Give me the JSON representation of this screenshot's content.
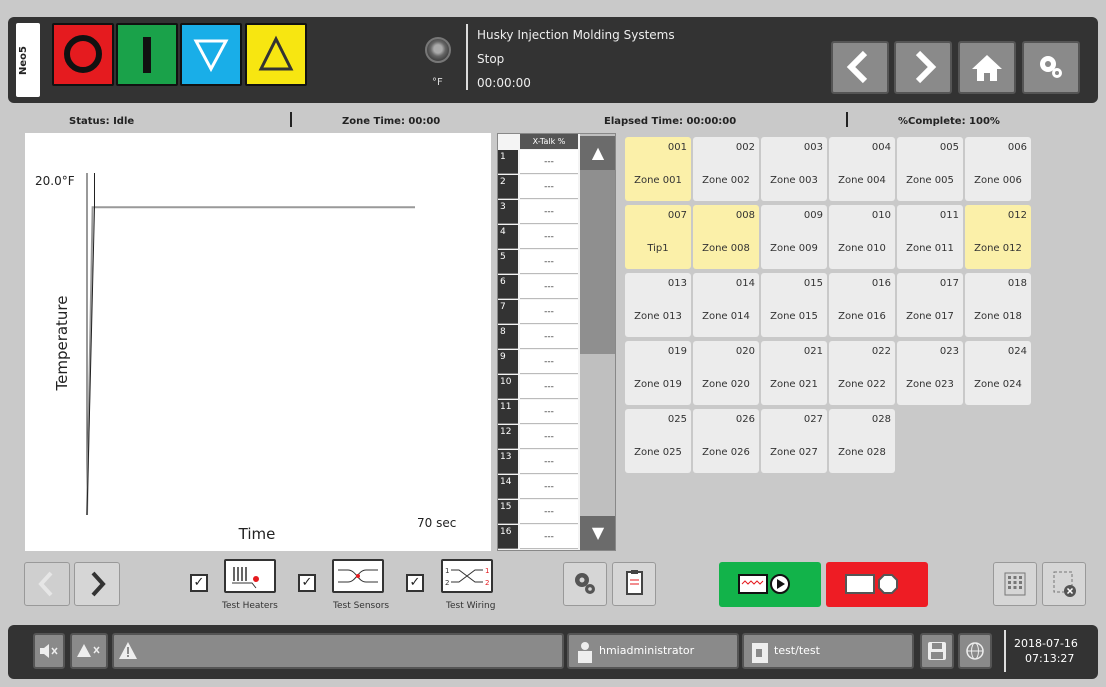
{
  "header": {
    "neo_tab": "Neo5",
    "unit": "°F",
    "company": "Husky Injection Molding Systems",
    "state": "Stop",
    "clock": "00:00:00"
  },
  "status": {
    "status": "Status: Idle",
    "zone_time": "Zone Time: 00:00",
    "elapsed": "Elapsed Time: 00:00:00",
    "complete": "%Complete: 100%"
  },
  "chart_data": {
    "type": "line",
    "ylabel": "Temperature",
    "xlabel": "Time",
    "y_max_label": "20.0°F",
    "x_max_label": "70 sec",
    "series": [
      {
        "x": [
          0,
          1.2,
          70
        ],
        "y": [
          0,
          18,
          18
        ]
      },
      {
        "x": [
          0,
          1.6,
          1.6
        ],
        "y": [
          0,
          18,
          20
        ]
      }
    ],
    "xlim": [
      0,
      70
    ],
    "ylim": [
      0,
      20
    ],
    "grid": false
  },
  "xtalk": {
    "header": "X-Talk %",
    "rows": [
      {
        "n": "1",
        "v": "---"
      },
      {
        "n": "2",
        "v": "---"
      },
      {
        "n": "3",
        "v": "---"
      },
      {
        "n": "4",
        "v": "---"
      },
      {
        "n": "5",
        "v": "---"
      },
      {
        "n": "6",
        "v": "---"
      },
      {
        "n": "7",
        "v": "---"
      },
      {
        "n": "8",
        "v": "---"
      },
      {
        "n": "9",
        "v": "---"
      },
      {
        "n": "10",
        "v": "---"
      },
      {
        "n": "11",
        "v": "---"
      },
      {
        "n": "12",
        "v": "---"
      },
      {
        "n": "13",
        "v": "---"
      },
      {
        "n": "14",
        "v": "---"
      },
      {
        "n": "15",
        "v": "---"
      },
      {
        "n": "16",
        "v": "---"
      }
    ]
  },
  "zones": [
    {
      "id": "001",
      "name": "Zone 001",
      "hl": true
    },
    {
      "id": "002",
      "name": "Zone 002",
      "hl": false
    },
    {
      "id": "003",
      "name": "Zone 003",
      "hl": false
    },
    {
      "id": "004",
      "name": "Zone 004",
      "hl": false
    },
    {
      "id": "005",
      "name": "Zone 005",
      "hl": false
    },
    {
      "id": "006",
      "name": "Zone 006",
      "hl": false
    },
    {
      "id": "007",
      "name": "Tip1",
      "hl": true
    },
    {
      "id": "008",
      "name": "Zone 008",
      "hl": true
    },
    {
      "id": "009",
      "name": "Zone 009",
      "hl": false
    },
    {
      "id": "010",
      "name": "Zone 010",
      "hl": false
    },
    {
      "id": "011",
      "name": "Zone 011",
      "hl": false
    },
    {
      "id": "012",
      "name": "Zone 012",
      "hl": true
    },
    {
      "id": "013",
      "name": "Zone 013",
      "hl": false
    },
    {
      "id": "014",
      "name": "Zone 014",
      "hl": false
    },
    {
      "id": "015",
      "name": "Zone 015",
      "hl": false
    },
    {
      "id": "016",
      "name": "Zone 016",
      "hl": false
    },
    {
      "id": "017",
      "name": "Zone 017",
      "hl": false
    },
    {
      "id": "018",
      "name": "Zone 018",
      "hl": false
    },
    {
      "id": "019",
      "name": "Zone 019",
      "hl": false
    },
    {
      "id": "020",
      "name": "Zone 020",
      "hl": false
    },
    {
      "id": "021",
      "name": "Zone 021",
      "hl": false
    },
    {
      "id": "022",
      "name": "Zone 022",
      "hl": false
    },
    {
      "id": "023",
      "name": "Zone 023",
      "hl": false
    },
    {
      "id": "024",
      "name": "Zone 024",
      "hl": false
    },
    {
      "id": "025",
      "name": "Zone 025",
      "hl": false
    },
    {
      "id": "026",
      "name": "Zone 026",
      "hl": false
    },
    {
      "id": "027",
      "name": "Zone 027",
      "hl": false
    },
    {
      "id": "028",
      "name": "Zone 028",
      "hl": false
    }
  ],
  "toolbar": {
    "test_heaters": "Test Heaters",
    "test_sensors": "Test Sensors",
    "test_wiring": "Test Wiring",
    "check_mark": "✓"
  },
  "footer": {
    "user": "hmiadministrator",
    "mold": "test/test",
    "date": "2018-07-16",
    "time": "07:13:27"
  },
  "colors": {
    "stop": "#e51b1f",
    "run": "#1aa24a",
    "down": "#19aee8",
    "up": "#f7e611",
    "highlight_zone": "#fbf0a9",
    "start_test": "#12b34a",
    "stop_test": "#ee1c24"
  }
}
